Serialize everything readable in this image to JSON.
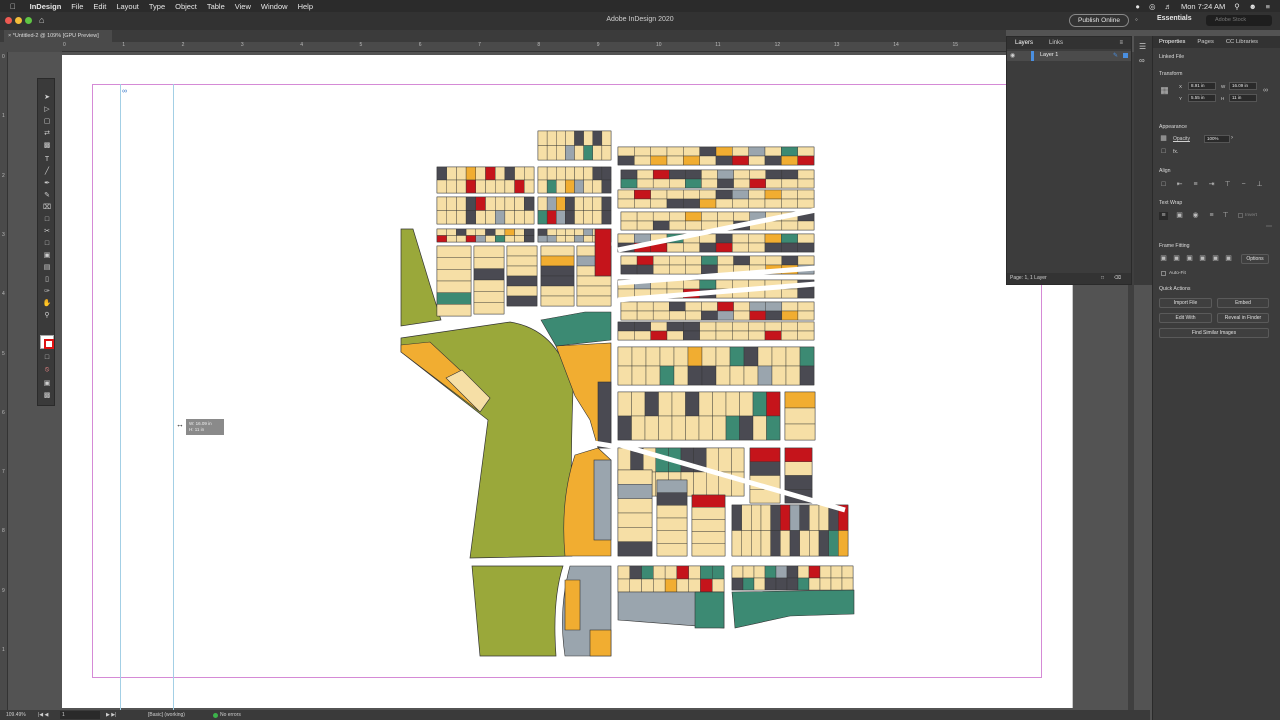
{
  "menubar": {
    "app": "InDesign",
    "menus": [
      "File",
      "Edit",
      "Layout",
      "Type",
      "Object",
      "Table",
      "View",
      "Window",
      "Help"
    ],
    "clock": "Mon 7:24 AM"
  },
  "window": {
    "title": "Adobe InDesign 2020",
    "doc_tab": "*Untitled-2 @ 109% [GPU Preview]",
    "publish_label": "Publish Online",
    "workspace": "Essentials",
    "stock_placeholder": "Adobe Stock"
  },
  "rulers": {
    "h": [
      "0",
      "1",
      "2",
      "3",
      "4",
      "5",
      "6",
      "7",
      "8",
      "9",
      "10",
      "11",
      "12",
      "13",
      "14",
      "15"
    ],
    "v": [
      "0",
      "1",
      "2",
      "3",
      "4",
      "5",
      "6",
      "7",
      "8",
      "9",
      "1"
    ]
  },
  "tooltip": {
    "w": "W: 16.09 in",
    "h": "H: 11 in"
  },
  "status": {
    "zoom": "109.49%",
    "page": "1",
    "preflight_profile": "[Basic] (working)",
    "errors": "No errors"
  },
  "layers_panel": {
    "tabs": [
      "Layers",
      "Links"
    ],
    "layer_name": "Layer 1",
    "footer": "Page: 1, 1 Layer"
  },
  "properties": {
    "tabs": [
      "Properties",
      "Pages",
      "CC Libraries"
    ],
    "object_type": "Linked File",
    "transform": {
      "label": "Transform",
      "x": "8.91 in",
      "y": "5.55 in",
      "w": "16.09 in",
      "h": "11 in"
    },
    "appearance": {
      "label": "Appearance",
      "opacity_label": "Opacity",
      "opacity": "100%",
      "fx": "fx."
    },
    "align_label": "Align",
    "text_wrap": {
      "label": "Text Wrap",
      "invert": "Invert"
    },
    "frame_fitting": {
      "label": "Frame Fitting",
      "options": "Options",
      "auto_fit": "Auto-Fit"
    },
    "quick_actions": {
      "label": "Quick Actions",
      "import_file": "Import File",
      "embed": "Embed",
      "edit_with": "Edit With",
      "reveal": "Reveal in Finder",
      "find_similar": "Find Similar Images"
    }
  },
  "colors": {
    "parcel_tan": "#f6dfa6",
    "park_green": "#9aa83a",
    "teal": "#3c8a73",
    "dark_gray": "#4a4a52",
    "light_gray": "#9aa5ae",
    "red": "#c5141b",
    "orange": "#f1ad31",
    "margin_guide": "#d58ad6"
  }
}
